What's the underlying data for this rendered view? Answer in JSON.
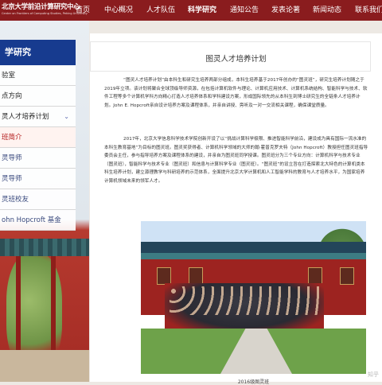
{
  "header": {
    "logo_cn": "北京大学前沿计算研究中心",
    "logo_en": "Center on Frontiers of Computing Studies, Peking University",
    "nav": [
      "首页",
      "中心概况",
      "人才队伍",
      "科学研究",
      "通知公告",
      "发表论著",
      "新闻动态",
      "联系我们"
    ]
  },
  "sidebar": {
    "heading": "学研究",
    "items": [
      {
        "label": "验室"
      },
      {
        "label": "点方向"
      },
      {
        "label": "灵人才培养计划"
      },
      {
        "label": "班简介"
      },
      {
        "label": "灵导师"
      },
      {
        "label": "灵导师"
      },
      {
        "label": "灵班校友"
      },
      {
        "label": "ohn Hopcroft 基金"
      }
    ]
  },
  "main": {
    "title": "图灵人才培养计划",
    "paragraphs": [
      "“图灵人才培养计划”由本科生和研究生培养两部分组成，本科生培养基于2017年创办的“图灵班”，研究生培养计划随之于2019年立项。该计划将聚合全球顶级导师资源，在包括计算机软件与理论、计算机应用技术、计算机系统结构、智能科学与技术、软件工程等多个计算机学科方向精心打造人才培养体系和学科建设方案，形成国际领先的从本科生到博士研究生的全链条人才培养计划。John E. Hopcroft亲自设计培养方案及课程体系，并亲自讲授、旁听及一对一交流相关课程，确保课堂质量。",
      "2017年，北京大学信息科学技术学院创新开设了以“挑战计算科学极限、推进智能科学前沿，建设成为具有国际一流水准的本科生教育基地”为目标的图灵班。图灵奖获得者、计算机科学领域的大师的翰·霍普克罗夫特（John Hopcroft）教授担任图灵班指导委员会主任，参与指导培养方案及课程体系的建设，并亲自为图灵班同学授课。图灵班分为三个专业方向：计算机科学与技术专业（图灵班），智能科学与技术专业（图灵班）和信息与计算科学专业（图灵班）。“图灵班”的设立旨在打造探索北大特色的计算机类本科生培养计划，建立源理教学与科研培养的示范体系，全面提升北京大学计算机和人工智能学科的教育与人才培养水平，为国家培养计算机领域未来的领军人才。"
    ],
    "photo_caption": "2016级图灵班"
  },
  "watermark": "知乎"
}
